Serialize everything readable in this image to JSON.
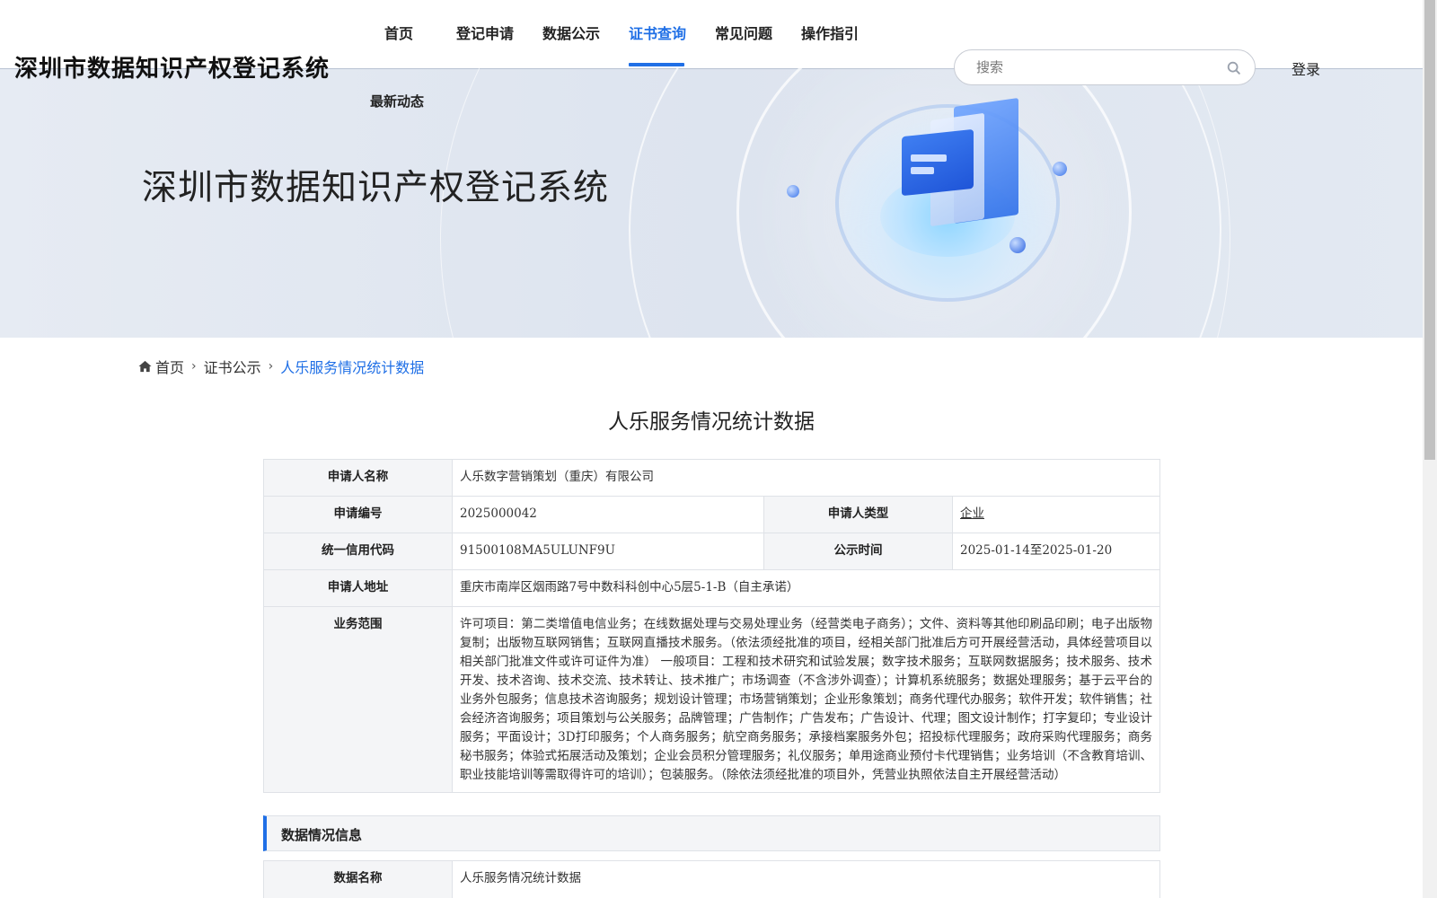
{
  "header": {
    "site_title": "深圳市数据知识产权登记系统",
    "nav": [
      {
        "label": "首页",
        "active": false
      },
      {
        "label": "登记申请",
        "active": false
      },
      {
        "label": "数据公示",
        "active": false
      },
      {
        "label": "证书查询",
        "active": true
      },
      {
        "label": "常见问题",
        "active": false
      },
      {
        "label": "操作指引",
        "active": false
      }
    ],
    "nav_latest": "最新动态",
    "search_placeholder": "搜索",
    "login_label": "登录"
  },
  "banner": {
    "title": "深圳市数据知识产权登记系统"
  },
  "breadcrumb": {
    "home": "首页",
    "level2": "证书公示",
    "current": "人乐服务情况统计数据"
  },
  "page_title": "人乐服务情况统计数据",
  "info": {
    "applicant_name_label": "申请人名称",
    "applicant_name": "人乐数字营销策划（重庆）有限公司",
    "app_no_label": "申请编号",
    "app_no": "2025000042",
    "applicant_type_label": "申请人类型",
    "applicant_type": "企业",
    "credit_code_label": "统一信用代码",
    "credit_code": "91500108MA5ULUNF9U",
    "publicity_time_label": "公示时间",
    "publicity_time": "2025-01-14至2025-01-20",
    "address_label": "申请人地址",
    "address": "重庆市南岸区烟雨路7号中数科科创中心5层5-1-B（自主承诺）",
    "scope_label": "业务范围",
    "scope": "许可项目：第二类增值电信业务；在线数据处理与交易处理业务（经营类电子商务）；文件、资料等其他印刷品印刷；电子出版物复制；出版物互联网销售；互联网直播技术服务。（依法须经批准的项目，经相关部门批准后方可开展经营活动，具体经营项目以相关部门批准文件或许可证件为准） 一般项目：工程和技术研究和试验发展；数字技术服务；互联网数据服务；技术服务、技术开发、技术咨询、技术交流、技术转让、技术推广；市场调查（不含涉外调查）；计算机系统服务；数据处理服务；基于云平台的业务外包服务；信息技术咨询服务；规划设计管理；市场营销策划；企业形象策划；商务代理代办服务；软件开发；软件销售；社会经济咨询服务；项目策划与公关服务；品牌管理；广告制作；广告发布；广告设计、代理；图文设计制作；打字复印；专业设计服务；平面设计；3D打印服务；个人商务服务；航空商务服务；承接档案服务外包；招投标代理服务；政府采购代理服务；商务秘书服务；体验式拓展活动及策划；企业会员积分管理服务；礼仪服务；单用途商业预付卡代理销售；业务培训（不含教育培训、职业技能培训等需取得许可的培训）；包装服务。（除依法须经批准的项目外，凭营业执照依法自主开展经营活动）"
  },
  "data_section": {
    "title": "数据情况信息",
    "data_name_label": "数据名称",
    "data_name": "人乐服务情况统计数据"
  }
}
